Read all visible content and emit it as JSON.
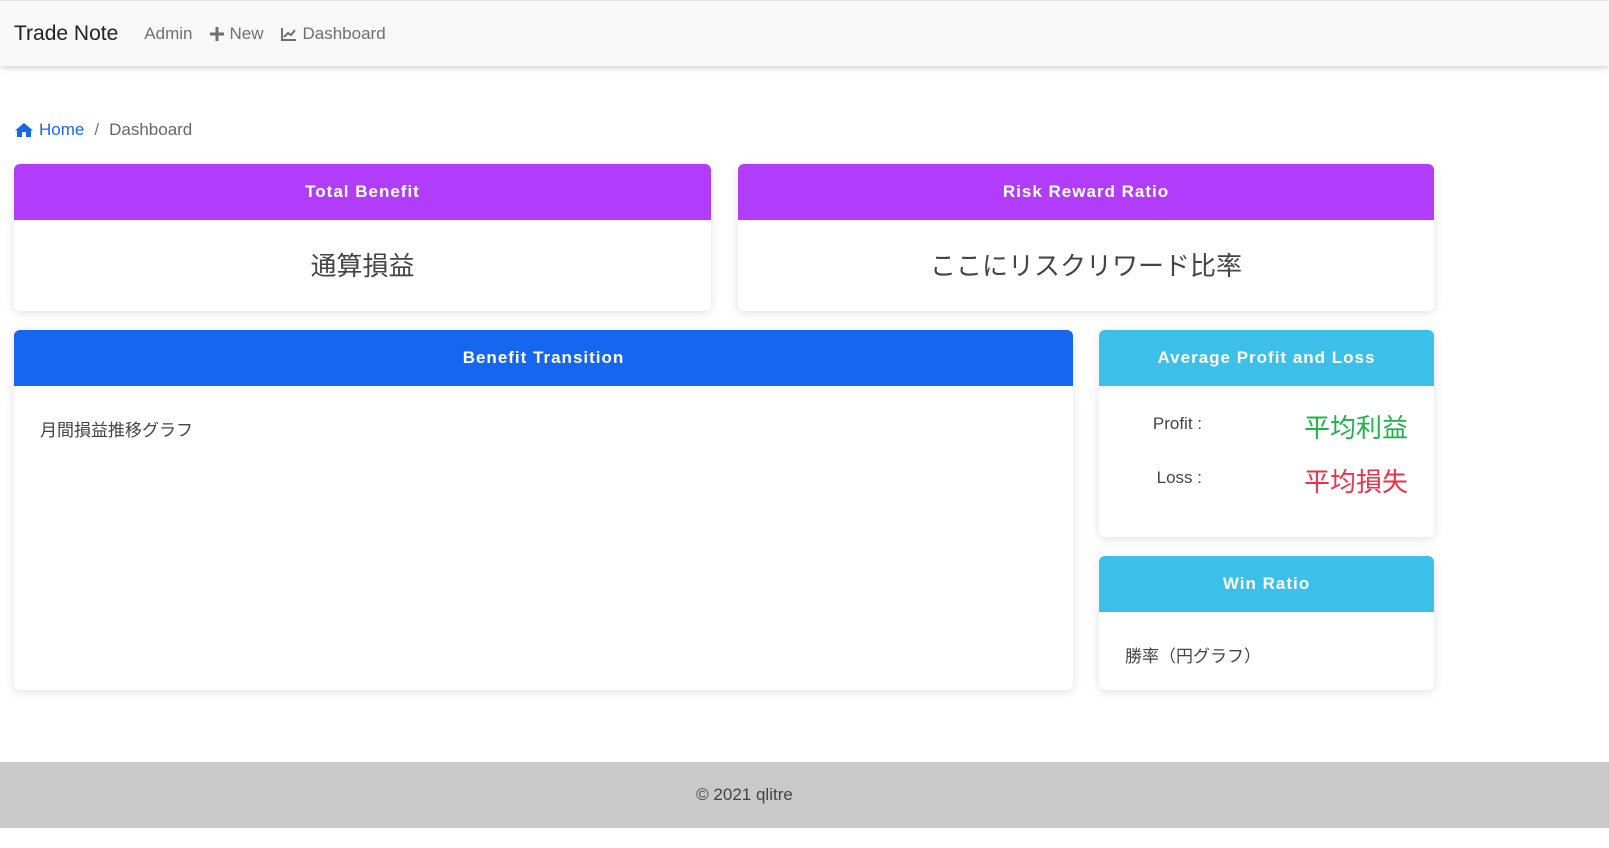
{
  "navbar": {
    "brand": "Trade Note",
    "links": [
      {
        "label": "Admin",
        "icon": ""
      },
      {
        "label": "New",
        "icon": "plus-icon"
      },
      {
        "label": "Dashboard",
        "icon": "line-chart-icon"
      }
    ]
  },
  "breadcrumb": {
    "home": "Home",
    "separator": "/",
    "current": "Dashboard"
  },
  "cards": {
    "total_benefit": {
      "title": "Total Benefit",
      "value": "通算損益"
    },
    "risk_reward": {
      "title": "Risk Reward Ratio",
      "value": "ここにリスクリワード比率"
    },
    "benefit_transition": {
      "title": "Benefit Transition",
      "text": "月間損益推移グラフ"
    },
    "avg_profit_loss": {
      "title": "Average Profit and Loss",
      "profit_label": "Profit :",
      "profit_value": "平均利益",
      "loss_label": "Loss :",
      "loss_value": "平均損失"
    },
    "win_ratio": {
      "title": "Win Ratio",
      "text": "勝率（円グラフ）"
    }
  },
  "footer": {
    "text": "© 2021 qlitre"
  },
  "colors": {
    "purple": "#b23cfc",
    "blue": "#1666f0",
    "cyan": "#3cc0ea",
    "profit": "#1db34a",
    "loss": "#ea3248",
    "link": "#1a66e8"
  }
}
